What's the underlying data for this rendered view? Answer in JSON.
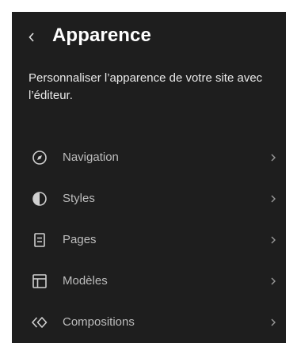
{
  "header": {
    "back_icon": "chevron-left-icon",
    "title": "Apparence"
  },
  "description": "Personnaliser l’apparence de votre site avec l’éditeur.",
  "menu": {
    "items": [
      {
        "label": "Navigation",
        "icon": "compass-icon"
      },
      {
        "label": "Styles",
        "icon": "half-circle-icon"
      },
      {
        "label": "Pages",
        "icon": "page-icon"
      },
      {
        "label": "Modèles",
        "icon": "layout-icon"
      },
      {
        "label": "Compositions",
        "icon": "symbol-icon"
      }
    ],
    "chevron_icon": "chevron-right-icon"
  },
  "colors": {
    "panel_background": "#1e1e1e",
    "title": "#ffffff",
    "label": "#bdbdbd",
    "icon": "#d0d0d0"
  }
}
